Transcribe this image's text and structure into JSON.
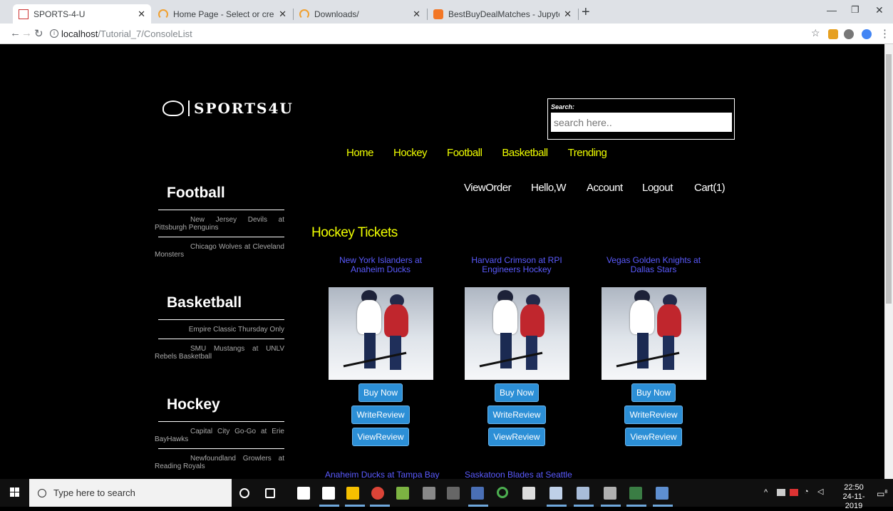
{
  "browser": {
    "tabs": [
      {
        "title": "SPORTS-4-U",
        "active": true
      },
      {
        "title": "Home Page - Select or create a n",
        "active": false
      },
      {
        "title": "Downloads/",
        "active": false
      },
      {
        "title": "BestBuyDealMatches - Jupyter N",
        "active": false
      }
    ],
    "url_host": "localhost",
    "url_path": "/Tutorial_7/ConsoleList"
  },
  "site": {
    "logo_text": "SPORTS4U",
    "search": {
      "label": "Search:",
      "placeholder": "search here.."
    },
    "nav": [
      "Home",
      "Hockey",
      "Football",
      "Basketball",
      "Trending"
    ],
    "user_nav": [
      "ViewOrder",
      "Hello,W",
      "Account",
      "Logout",
      "Cart(1)"
    ]
  },
  "sidebar": [
    {
      "title": "Football",
      "items": [
        "New Jersey Devils at Pittsburgh Penguins",
        "Chicago Wolves at Cleveland Monsters"
      ]
    },
    {
      "title": "Basketball",
      "items": [
        "Empire Classic Thursday Only",
        "SMU Mustangs at UNLV Rebels Basketball"
      ]
    },
    {
      "title": "Hockey",
      "items": [
        "Capital City Go-Go at Erie BayHawks",
        "Newfoundland Growlers at Reading Royals"
      ]
    }
  ],
  "main": {
    "section_title": "Hockey Tickets",
    "cards": [
      {
        "name": "New York Islanders at Anaheim Ducks"
      },
      {
        "name": "Harvard Crimson at RPI Engineers Hockey"
      },
      {
        "name": "Vegas Golden Knights at Dallas Stars"
      }
    ],
    "buttons": {
      "buy": "Buy Now",
      "write": "WriteReview",
      "view": "ViewReview"
    },
    "next_row": [
      "Anaheim Ducks at Tampa Bay",
      "Saskatoon Blades at Seattle"
    ]
  },
  "taskbar": {
    "search_placeholder": "Type here to search",
    "time": "22:50",
    "date": "24-11-2019",
    "notification_count": "8"
  }
}
